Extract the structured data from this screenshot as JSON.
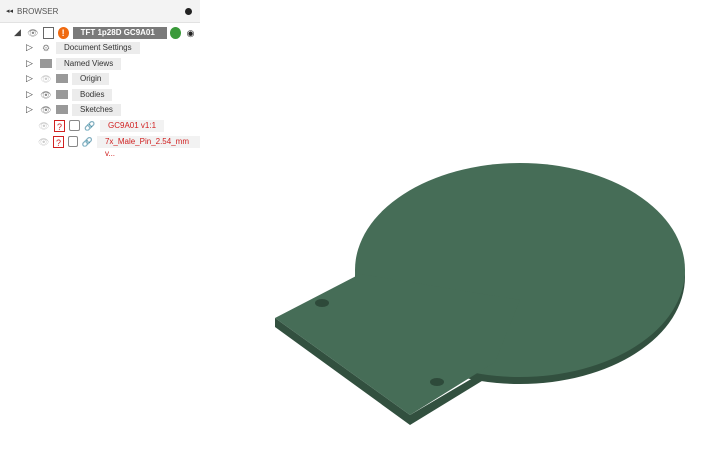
{
  "browser": {
    "title": "BROWSER",
    "root": "TFT 1p28D GC9A01 v...",
    "items": [
      {
        "label": "Document Settings"
      },
      {
        "label": "Named Views"
      },
      {
        "label": "Origin"
      },
      {
        "label": "Bodies"
      },
      {
        "label": "Sketches"
      },
      {
        "label": "GC9A01 v1:1"
      },
      {
        "label": "7x_Male_Pin_2.54_mm v..."
      }
    ]
  },
  "colors": {
    "body_top": "#466d57",
    "body_side": "#32503f",
    "error": "#e02020"
  }
}
